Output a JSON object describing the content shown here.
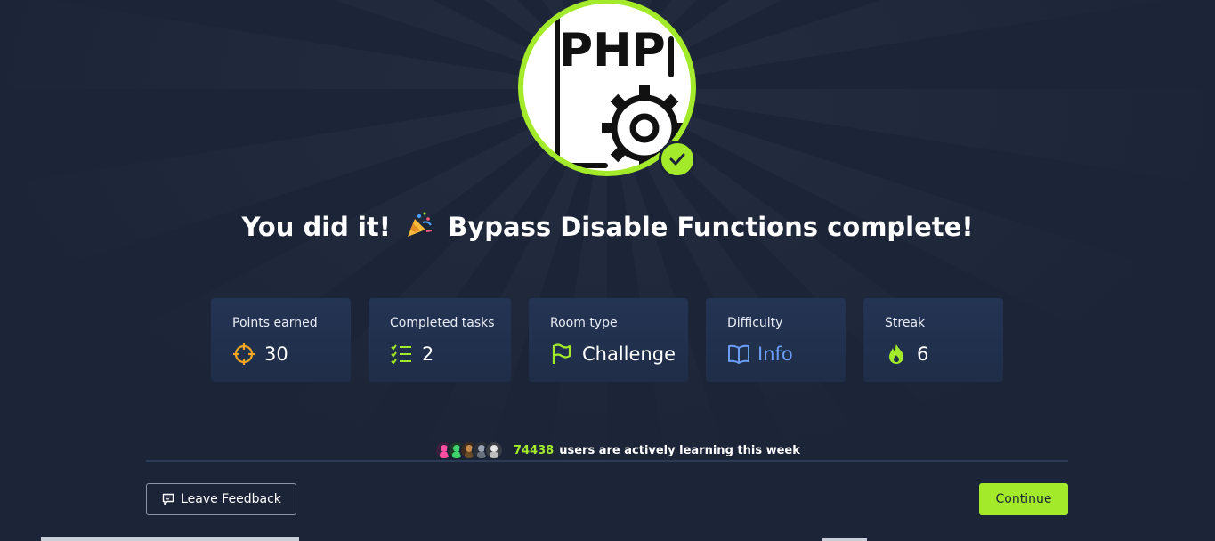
{
  "room": {
    "badge_icon": "php-gear-icon",
    "completed_icon": "checkmark-icon",
    "accent_color": "#a3ea2a"
  },
  "headline": {
    "prefix": "You did it!",
    "emoji_icon": "party-popper-icon",
    "suffix": "Bypass Disable Functions complete!"
  },
  "stats": [
    {
      "label": "Points earned",
      "value": "30",
      "icon": "crosshair-icon",
      "icon_color": "#f5a623"
    },
    {
      "label": "Completed tasks",
      "value": "2",
      "icon": "checklist-icon",
      "icon_color": "#a3ea2a"
    },
    {
      "label": "Room type",
      "value": "Challenge",
      "icon": "flag-icon",
      "icon_color": "#a3ea2a"
    },
    {
      "label": "Difficulty",
      "value": "Info",
      "icon": "book-icon",
      "icon_color": "#6c9df5"
    },
    {
      "label": "Streak",
      "value": "6",
      "icon": "flame-icon",
      "icon_color": "#a3ea2a"
    }
  ],
  "learners": {
    "count": "74438",
    "text": "users are actively learning this week"
  },
  "buttons": {
    "feedback_label": "Leave Feedback",
    "continue_label": "Continue"
  }
}
